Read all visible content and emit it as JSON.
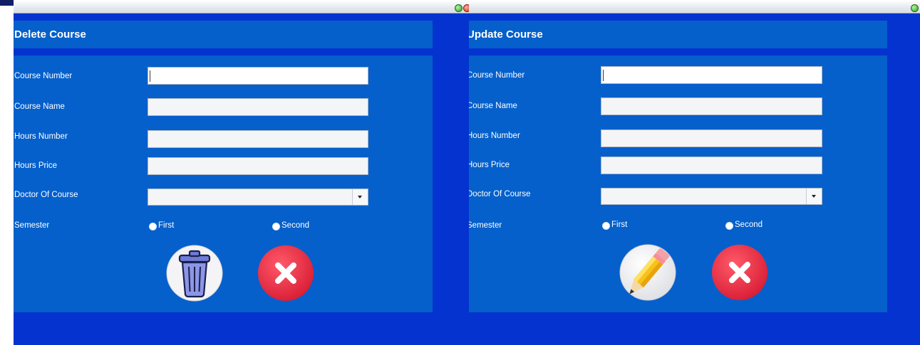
{
  "forms": [
    {
      "title": "Delete Course",
      "fields": {
        "course_number": {
          "label": "Course Number",
          "value": ""
        },
        "course_name": {
          "label": "Course Name",
          "value": ""
        },
        "hours_number": {
          "label": "Hours Number",
          "value": ""
        },
        "hours_price": {
          "label": "Hours Price",
          "value": ""
        },
        "doctor": {
          "label": "Doctor Of Course",
          "value": ""
        },
        "semester": {
          "label": "Semester",
          "options": [
            "First",
            "Second"
          ]
        }
      },
      "primary_action_icon": "trash-icon",
      "cancel_icon": "close-icon"
    },
    {
      "title": "Update Course",
      "fields": {
        "course_number": {
          "label": "Course Number",
          "value": ""
        },
        "course_name": {
          "label": "Course Name",
          "value": ""
        },
        "hours_number": {
          "label": "Hours Number",
          "value": ""
        },
        "hours_price": {
          "label": "Hours Price",
          "value": ""
        },
        "doctor": {
          "label": "Doctor Of Course",
          "value": ""
        },
        "semester": {
          "label": "Semester",
          "options": [
            "First",
            "Second"
          ]
        }
      },
      "primary_action_icon": "pencil-icon",
      "cancel_icon": "close-icon"
    }
  ],
  "colors": {
    "window_bg": "#0533cf",
    "panel_bg": "#0560cb",
    "close_button": "#e3283f",
    "text": "#ffffff"
  }
}
